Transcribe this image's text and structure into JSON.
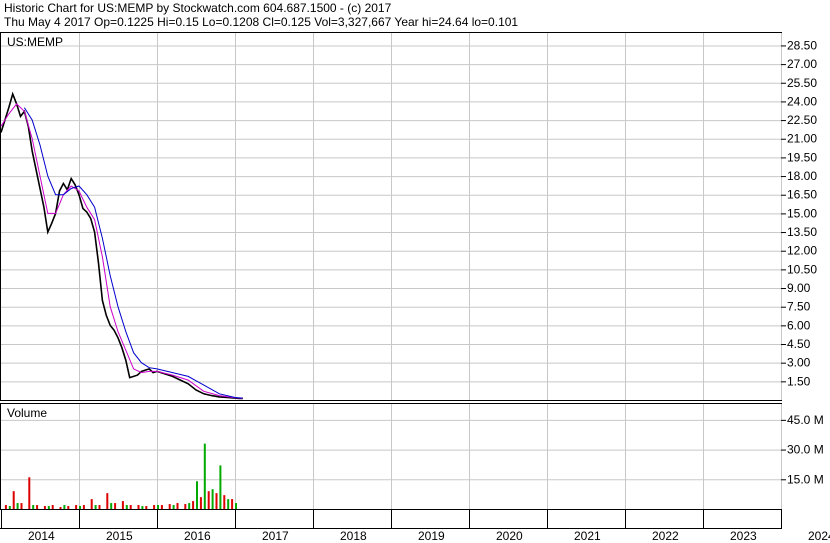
{
  "header": {
    "line1": "Historic Chart for US:MEMP by Stockwatch.com 604.687.1500 - (c) 2017",
    "line2": "Thu May  4 2017   Op=0.1225   Hi=0.15   Lo=0.1208   Cl=0.125   Vol=3,327,667   Year hi=24.64   lo=0.101"
  },
  "colors": {
    "price": "#000000",
    "ma_short": "#cc00cc",
    "ma_long": "#0000cc",
    "vol_up": "#00aa00",
    "vol_down": "#dd0000",
    "grid": "#c8c8c8"
  },
  "chart_data": [
    {
      "type": "line",
      "title": "US:MEMP",
      "x_categories": [
        "2014",
        "2015",
        "2016",
        "2017",
        "2018",
        "2019",
        "2020",
        "2021",
        "2022",
        "2023",
        "2024"
      ],
      "y_ticks": [
        "28.50",
        "27.00",
        "25.50",
        "24.00",
        "22.50",
        "21.00",
        "19.50",
        "18.00",
        "16.50",
        "15.00",
        "13.50",
        "12.00",
        "10.50",
        "9.00",
        "7.50",
        "6.00",
        "4.50",
        "3.00",
        "1.50"
      ],
      "ylim": [
        0,
        29.5
      ],
      "grid": true,
      "series": [
        {
          "color": "price",
          "x": [
            2014.0,
            2014.05,
            2014.1,
            2014.15,
            2014.2,
            2014.25,
            2014.3,
            2014.35,
            2014.4,
            2014.45,
            2014.5,
            2014.55,
            2014.6,
            2014.65,
            2014.7,
            2014.75,
            2014.8,
            2014.85,
            2014.9,
            2014.95,
            2015.0,
            2015.05,
            2015.1,
            2015.15,
            2015.2,
            2015.25,
            2015.3,
            2015.35,
            2015.4,
            2015.45,
            2015.5,
            2015.55,
            2015.6,
            2015.65,
            2015.7,
            2015.75,
            2015.8,
            2015.85,
            2015.9,
            2015.95,
            2016.0,
            2016.1,
            2016.2,
            2016.3,
            2016.4,
            2016.5,
            2016.6,
            2016.7,
            2016.8,
            2016.9,
            2017.0,
            2017.05,
            2017.1
          ],
          "y": [
            21.5,
            22.5,
            23.5,
            24.6,
            23.8,
            22.8,
            23.2,
            22.0,
            20.0,
            18.5,
            17.0,
            15.5,
            13.5,
            14.2,
            15.0,
            16.8,
            17.4,
            16.9,
            17.8,
            17.3,
            16.5,
            15.4,
            15.1,
            14.6,
            13.5,
            11.0,
            8.0,
            6.8,
            6.0,
            5.6,
            5.0,
            4.2,
            3.2,
            1.8,
            1.9,
            2.0,
            2.3,
            2.4,
            2.5,
            2.2,
            2.3,
            2.1,
            1.9,
            1.6,
            1.3,
            0.8,
            0.5,
            0.35,
            0.25,
            0.2,
            0.15,
            0.13,
            0.125
          ]
        },
        {
          "color": "ma_short",
          "x": [
            2014.0,
            2014.1,
            2014.2,
            2014.3,
            2014.4,
            2014.5,
            2014.6,
            2014.7,
            2014.8,
            2014.9,
            2015.0,
            2015.1,
            2015.2,
            2015.3,
            2015.4,
            2015.5,
            2015.6,
            2015.7,
            2015.8,
            2015.9,
            2016.0,
            2016.2,
            2016.4,
            2016.6,
            2016.8,
            2017.0,
            2017.1
          ],
          "y": [
            22.0,
            23.0,
            23.8,
            23.2,
            21.0,
            18.0,
            15.0,
            15.0,
            16.5,
            17.2,
            16.8,
            15.5,
            14.5,
            11.5,
            7.5,
            5.5,
            4.0,
            2.5,
            2.2,
            2.3,
            2.3,
            2.0,
            1.6,
            0.7,
            0.35,
            0.18,
            0.13
          ]
        },
        {
          "color": "ma_long",
          "x": [
            2014.3,
            2014.4,
            2014.5,
            2014.6,
            2014.7,
            2014.8,
            2014.9,
            2015.0,
            2015.1,
            2015.2,
            2015.3,
            2015.4,
            2015.5,
            2015.6,
            2015.7,
            2015.8,
            2015.9,
            2016.0,
            2016.2,
            2016.4,
            2016.6,
            2016.8,
            2017.0,
            2017.1
          ],
          "y": [
            23.5,
            22.5,
            20.5,
            18.0,
            16.5,
            16.5,
            17.0,
            17.2,
            16.5,
            15.5,
            13.0,
            10.0,
            7.5,
            5.5,
            3.8,
            3.0,
            2.6,
            2.5,
            2.2,
            1.9,
            1.2,
            0.5,
            0.2,
            0.15
          ]
        }
      ]
    },
    {
      "type": "bar",
      "title": "Volume",
      "y_ticks": [
        "45.0 M",
        "30.0 M",
        "15.0 M"
      ],
      "ylim": [
        0,
        53
      ],
      "series": [
        {
          "color": "vol_down",
          "x": [
            2014.05,
            2014.15,
            2014.25,
            2014.35,
            2014.45,
            2014.55,
            2014.65,
            2014.75,
            2014.85,
            2014.95,
            2015.05,
            2015.15,
            2015.25,
            2015.35,
            2015.45,
            2015.55,
            2015.65,
            2015.75,
            2015.85,
            2015.95,
            2016.05,
            2016.15,
            2016.25,
            2016.35,
            2016.45,
            2016.55,
            2016.65,
            2016.75,
            2016.85,
            2016.95
          ],
          "values": [
            2,
            9,
            3,
            16,
            2,
            1.5,
            2,
            1,
            1.5,
            2,
            2,
            5,
            2,
            8,
            3,
            4,
            2,
            2,
            1.5,
            2,
            2,
            2.5,
            3,
            2.5,
            4,
            6,
            9,
            8,
            7,
            5
          ]
        },
        {
          "color": "vol_up",
          "x": [
            2014.1,
            2014.2,
            2014.4,
            2014.6,
            2014.8,
            2015.0,
            2015.2,
            2015.4,
            2015.6,
            2015.8,
            2016.0,
            2016.2,
            2016.4,
            2016.5,
            2016.6,
            2016.7,
            2016.8,
            2016.9,
            2017.0
          ],
          "values": [
            1.5,
            3,
            2,
            1.5,
            2,
            1.5,
            2,
            3,
            2,
            1.5,
            2,
            2,
            3,
            14,
            33,
            10,
            22,
            5,
            3
          ]
        }
      ]
    }
  ]
}
